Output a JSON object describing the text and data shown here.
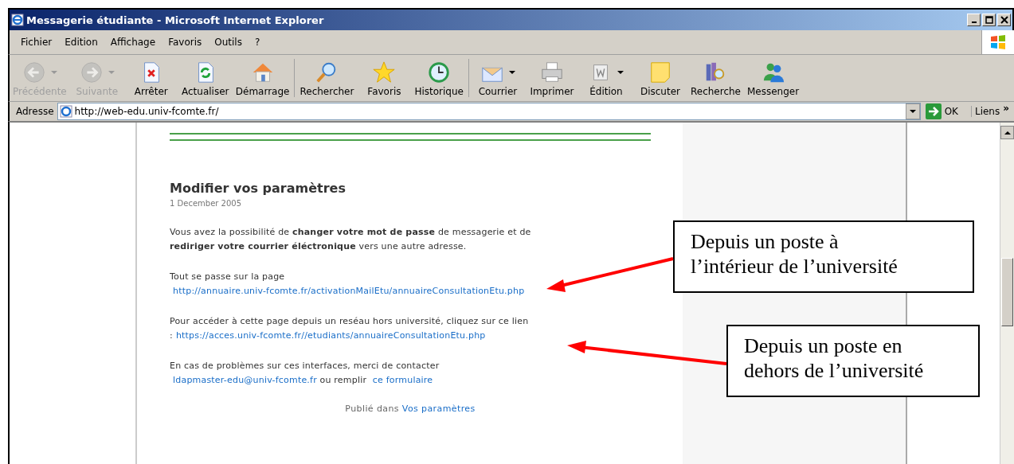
{
  "window": {
    "title": "Messagerie étudiante - Microsoft Internet Explorer"
  },
  "menu": [
    "Fichier",
    "Edition",
    "Affichage",
    "Favoris",
    "Outils",
    "?"
  ],
  "toolbar": [
    [
      {
        "label": "Précédente",
        "disabled": true,
        "dropdown": true
      },
      {
        "label": "Suivante",
        "disabled": true,
        "dropdown": true
      },
      {
        "label": "Arrêter",
        "disabled": false,
        "dropdown": false
      },
      {
        "label": "Actualiser",
        "disabled": false,
        "dropdown": false
      },
      {
        "label": "Démarrage",
        "disabled": false,
        "dropdown": false
      }
    ],
    [
      {
        "label": "Rechercher",
        "disabled": false,
        "dropdown": false
      },
      {
        "label": "Favoris",
        "disabled": false,
        "dropdown": false
      },
      {
        "label": "Historique",
        "disabled": false,
        "dropdown": false
      }
    ],
    [
      {
        "label": "Courrier",
        "disabled": false,
        "dropdown": true
      },
      {
        "label": "Imprimer",
        "disabled": false,
        "dropdown": false
      },
      {
        "label": "Édition",
        "disabled": false,
        "dropdown": true
      },
      {
        "label": "Discuter",
        "disabled": false,
        "dropdown": false
      },
      {
        "label": "Recherche",
        "disabled": false,
        "dropdown": false
      },
      {
        "label": "Messenger",
        "disabled": false,
        "dropdown": false
      }
    ]
  ],
  "address": {
    "label": "Adresse",
    "value": "http://web-edu.univ-fcomte.fr/",
    "go": "OK",
    "links": "Liens",
    "more": "»"
  },
  "article": {
    "title": "Modifier vos paramètres",
    "date": "1 December 2005",
    "paragraphs": [
      [
        {
          "kind": "text",
          "text": "Vous avez la possibilité de **changer votre mot de passe** de messagerie et de **rediriger votre courrier éléctronique** vers une autre adresse."
        }
      ],
      [
        {
          "kind": "text",
          "text": "Tout se passe sur la page "
        },
        {
          "kind": "link",
          "text": "http://annuaire.univ-fcomte.fr/activationMailEtu/annuaireConsultationEtu.php"
        }
      ],
      [
        {
          "kind": "text",
          "text": "Pour accéder à cette page depuis un reséau hors université, cliquez sur ce lien :"
        },
        {
          "kind": "link",
          "text": "https://acces.univ-fcomte.fr//etudiants/annuaireConsultationEtu.php"
        }
      ],
      [
        {
          "kind": "text",
          "text": "En cas de problèmes sur ces interfaces, merci de contacter "
        },
        {
          "kind": "link",
          "text": "ldapmaster-edu@univ-fcomte.fr"
        },
        {
          "kind": "text",
          "text": " ou remplir "
        },
        {
          "kind": "link",
          "text": "ce formulaire"
        }
      ]
    ],
    "published": {
      "text": "Publié dans ",
      "link": "Vos paramètres"
    }
  },
  "callouts": [
    {
      "lines": [
        "Depuis un poste à",
        "l’intérieur de l’université"
      ]
    },
    {
      "lines": [
        "Depuis un poste en",
        "dehors de l’université"
      ]
    }
  ]
}
